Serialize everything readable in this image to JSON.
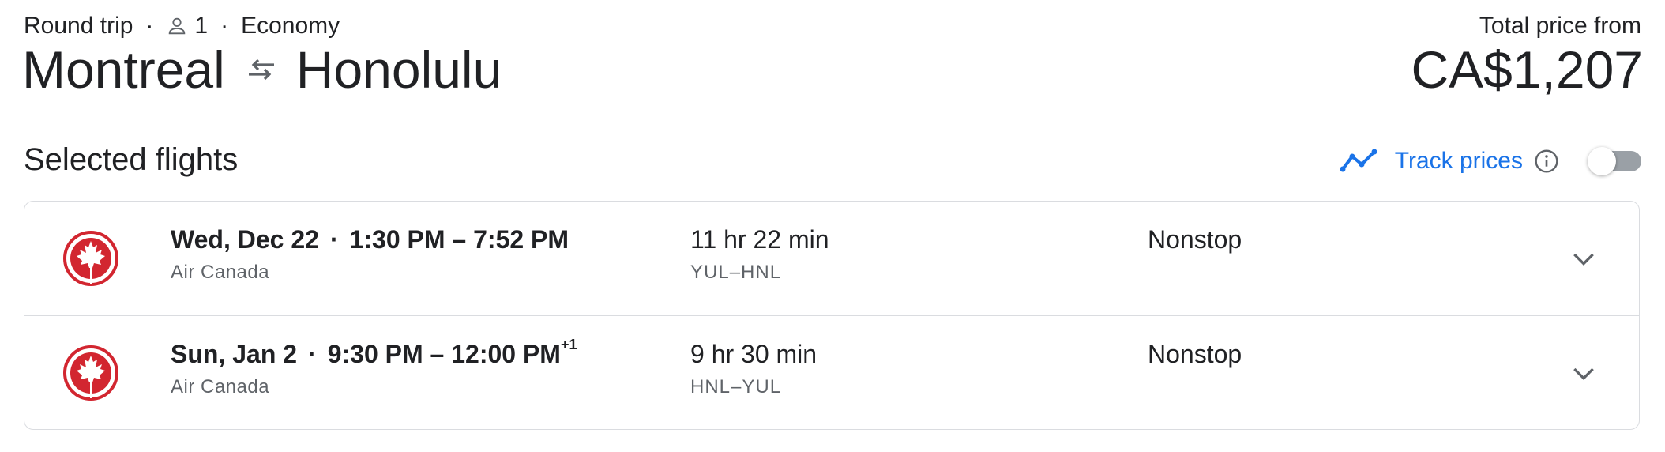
{
  "trip": {
    "type": "Round trip",
    "passengers": "1",
    "cabin": "Economy"
  },
  "route": {
    "origin": "Montreal",
    "destination": "Honolulu"
  },
  "price": {
    "label": "Total price from",
    "value": "CA$1,207"
  },
  "section": {
    "title": "Selected flights",
    "track_label": "Track prices",
    "track_enabled": false
  },
  "flights": [
    {
      "date": "Wed, Dec 22",
      "time_range": "1:30 PM – 7:52 PM",
      "day_offset": "",
      "airline": "Air Canada",
      "duration": "11 hr 22 min",
      "airports": "YUL–HNL",
      "stops": "Nonstop"
    },
    {
      "date": "Sun, Jan 2",
      "time_range": "9:30 PM – 12:00 PM",
      "day_offset": "+1",
      "airline": "Air Canada",
      "duration": "9 hr 30 min",
      "airports": "HNL–YUL",
      "stops": "Nonstop"
    }
  ],
  "icons": {
    "person": "person-icon",
    "swap": "swap-arrows-icon",
    "trend": "trend-line-icon",
    "info": "info-icon",
    "airline_logo": "air-canada-maple-leaf-icon",
    "expand": "chevron-down-icon"
  },
  "colors": {
    "accent": "#1a73e8",
    "brand_red": "#d22630",
    "text_primary": "#202124",
    "text_secondary": "#5f6368",
    "border": "#dadce0"
  }
}
